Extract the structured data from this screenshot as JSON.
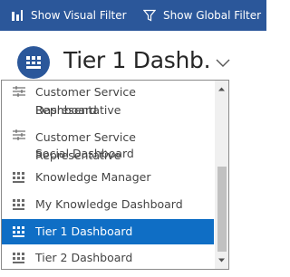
{
  "toolbar": {
    "show_visual_filter": "Show Visual Filter",
    "show_global_filter": "Show Global Filter"
  },
  "dashboard": {
    "title": "Tier 1 Dashb...",
    "icon": "dashboard-grid-icon"
  },
  "dropdown": {
    "items": [
      {
        "label_line1": "Customer Service Representative",
        "label_line2": "Dashboard",
        "icon": "interactive-dashboard-icon"
      },
      {
        "label_line1": "Customer Service Representative",
        "label_line2": "Social Dashboard",
        "icon": "interactive-dashboard-icon"
      },
      {
        "label": "Knowledge Manager",
        "icon": "dashboard-grid-icon"
      },
      {
        "label": "My Knowledge Dashboard",
        "icon": "dashboard-grid-icon"
      },
      {
        "label": "Tier 1 Dashboard",
        "icon": "dashboard-grid-icon",
        "selected": true
      },
      {
        "label": "Tier 2 Dashboard",
        "icon": "dashboard-grid-icon"
      }
    ]
  },
  "colors": {
    "toolbar_bg": "#2b579a",
    "selected_bg": "#0f6ec5",
    "text": "#444444"
  }
}
